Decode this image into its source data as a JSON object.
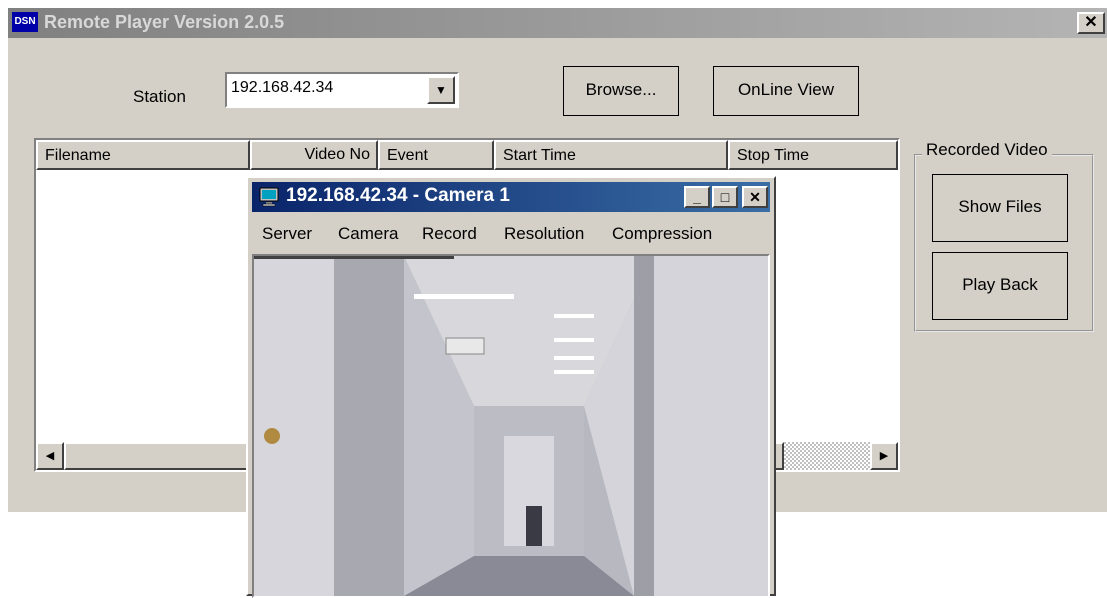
{
  "app": {
    "title": "Remote Player Version 2.0.5",
    "logo_text": "DSN",
    "close_glyph": "✕"
  },
  "station": {
    "label": "Station",
    "value": "192.168.42.34",
    "dropdown_glyph": "▼"
  },
  "buttons": {
    "browse": "Browse...",
    "online_view": "OnLine View",
    "show_files": "Show Files",
    "play_back": "Play Back"
  },
  "file_list": {
    "columns": [
      "Filename",
      "Video No",
      "Event",
      "Start Time",
      "Stop Time"
    ],
    "rows": [],
    "scroll_left_glyph": "◀",
    "scroll_right_glyph": "▶"
  },
  "recorded_video": {
    "group_label": "Recorded Video"
  },
  "camera_window": {
    "title": "192.168.42.34 - Camera 1",
    "minimize_glyph": "_",
    "maximize_glyph": "□",
    "close_glyph": "✕",
    "menu": [
      "Server",
      "Camera",
      "Record",
      "Resolution",
      "Compression"
    ]
  },
  "colors": {
    "window_bg": "#d4d0c8",
    "active_title": "#0a246a",
    "inactive_title": "#808080"
  },
  "icons": [
    "dsn-logo-icon",
    "close-icon",
    "chevron-down-icon",
    "arrow-left-icon",
    "arrow-right-icon",
    "monitor-icon",
    "minimize-icon",
    "maximize-icon"
  ]
}
